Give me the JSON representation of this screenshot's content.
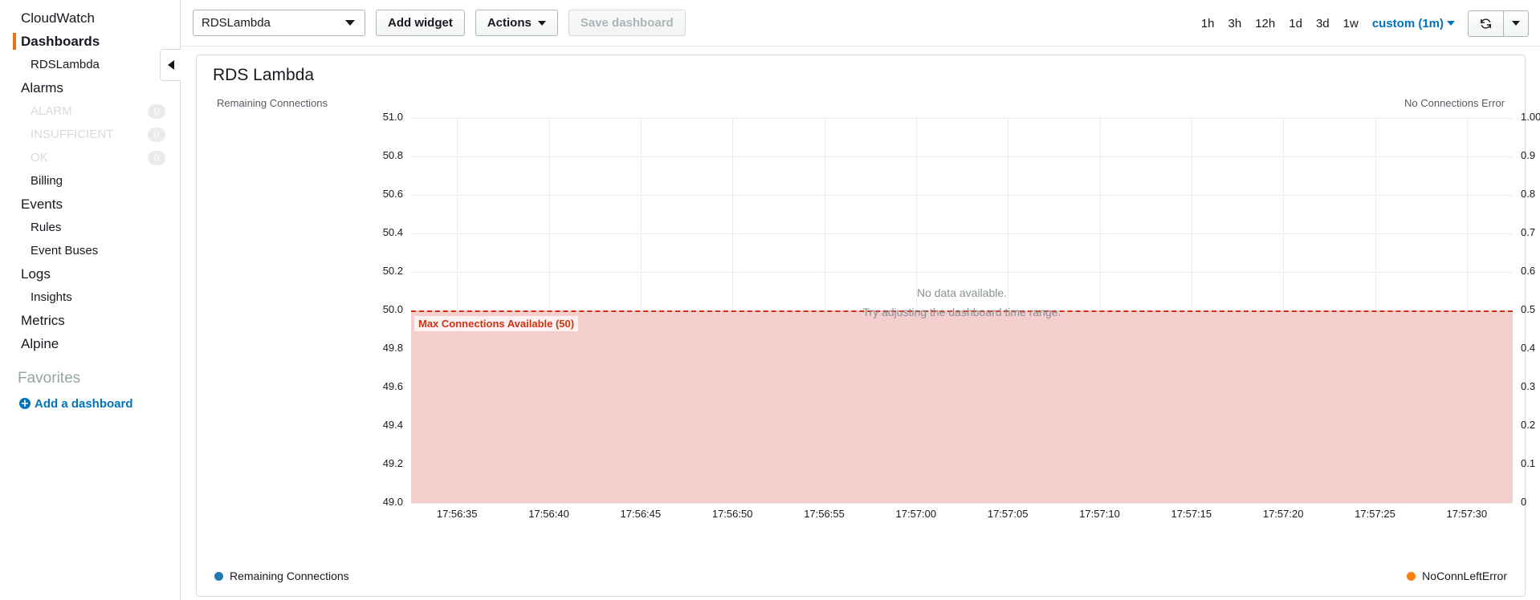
{
  "sidebar": {
    "items": [
      {
        "label": "CloudWatch",
        "level": 1,
        "state": "normal"
      },
      {
        "label": "Dashboards",
        "level": 1,
        "state": "selected"
      },
      {
        "label": "RDSLambda",
        "level": 2,
        "state": "normal"
      },
      {
        "label": "Alarms",
        "level": 1,
        "state": "normal"
      },
      {
        "label": "ALARM",
        "level": 2,
        "state": "muted",
        "count": "0"
      },
      {
        "label": "INSUFFICIENT",
        "level": 2,
        "state": "muted",
        "count": "0"
      },
      {
        "label": "OK",
        "level": 2,
        "state": "muted",
        "count": "0"
      },
      {
        "label": "Billing",
        "level": 2,
        "state": "normal"
      },
      {
        "label": "Events",
        "level": 1,
        "state": "normal"
      },
      {
        "label": "Rules",
        "level": 2,
        "state": "normal"
      },
      {
        "label": "Event Buses",
        "level": 2,
        "state": "normal"
      },
      {
        "label": "Logs",
        "level": 1,
        "state": "normal"
      },
      {
        "label": "Insights",
        "level": 2,
        "state": "normal"
      },
      {
        "label": "Metrics",
        "level": 1,
        "state": "normal"
      },
      {
        "label": "Alpine",
        "level": 1,
        "state": "normal"
      }
    ],
    "favorites_header": "Favorites",
    "add_dashboard_label": "Add a dashboard",
    "collapse_icon": "caret-left-icon",
    "accent_color": "#ec7211",
    "link_color": "#0073bb"
  },
  "toolbar": {
    "dashboard_select_value": "RDSLambda",
    "add_widget_label": "Add widget",
    "actions_label": "Actions",
    "save_dashboard_label": "Save dashboard",
    "save_dashboard_disabled": true,
    "time_ranges": [
      "1h",
      "3h",
      "12h",
      "1d",
      "3d",
      "1w"
    ],
    "custom_range_label": "custom (1m)",
    "refresh_icon": "refresh-icon",
    "refresh_caret_icon": "chevron-down-icon"
  },
  "widget": {
    "title": "RDS Lambda",
    "left_axis_title": "Remaining Connections",
    "right_axis_title": "No Connections Error",
    "no_data_line1": "No data available.",
    "no_data_line2": "Try adjusting the dashboard time range.",
    "annotation_label": "Max Connections Available (50)",
    "annotation_color": "#d13212",
    "annotation_fill": "#f3c6c6",
    "legend": [
      {
        "label": "Remaining Connections",
        "color": "#1f77b4"
      },
      {
        "label": "NoConnLeftError",
        "color": "#ff7f0e"
      }
    ]
  },
  "chart_data": {
    "type": "line",
    "title": "RDS Lambda",
    "xlabel": "",
    "ylabel": "Remaining Connections",
    "y2label": "No Connections Error",
    "grid": true,
    "legend_position": "bottom",
    "x_tick_labels": [
      "17:56:35",
      "17:56:40",
      "17:56:45",
      "17:56:50",
      "17:56:55",
      "17:57:00",
      "17:57:05",
      "17:57:10",
      "17:57:15",
      "17:57:20",
      "17:57:25",
      "17:57:30"
    ],
    "y_left_ticks": [
      "51.0",
      "50.8",
      "50.6",
      "50.4",
      "50.2",
      "50.0",
      "49.8",
      "49.6",
      "49.4",
      "49.2",
      "49.0"
    ],
    "y_left_values": [
      51.0,
      50.8,
      50.6,
      50.4,
      50.2,
      50.0,
      49.8,
      49.6,
      49.4,
      49.2,
      49.0
    ],
    "ylim": [
      49.0,
      51.0
    ],
    "y_right_ticks": [
      "1.00",
      "0.9",
      "0.8",
      "0.7",
      "0.6",
      "0.5",
      "0.4",
      "0.3",
      "0.2",
      "0.1",
      "0"
    ],
    "y_right_values": [
      1.0,
      0.9,
      0.8,
      0.7,
      0.6,
      0.5,
      0.4,
      0.3,
      0.2,
      0.1,
      0.0
    ],
    "y2lim": [
      0.0,
      1.0
    ],
    "series": [
      {
        "name": "Remaining Connections",
        "color": "#1f77b4",
        "axis": "left",
        "values": []
      },
      {
        "name": "NoConnLeftError",
        "color": "#ff7f0e",
        "axis": "right",
        "values": []
      }
    ],
    "annotations": [
      {
        "label": "Max Connections Available (50)",
        "value": 50.0,
        "axis": "left",
        "type": "horizontal-band-below",
        "color": "#d13212"
      }
    ],
    "empty_state": "No data available."
  }
}
